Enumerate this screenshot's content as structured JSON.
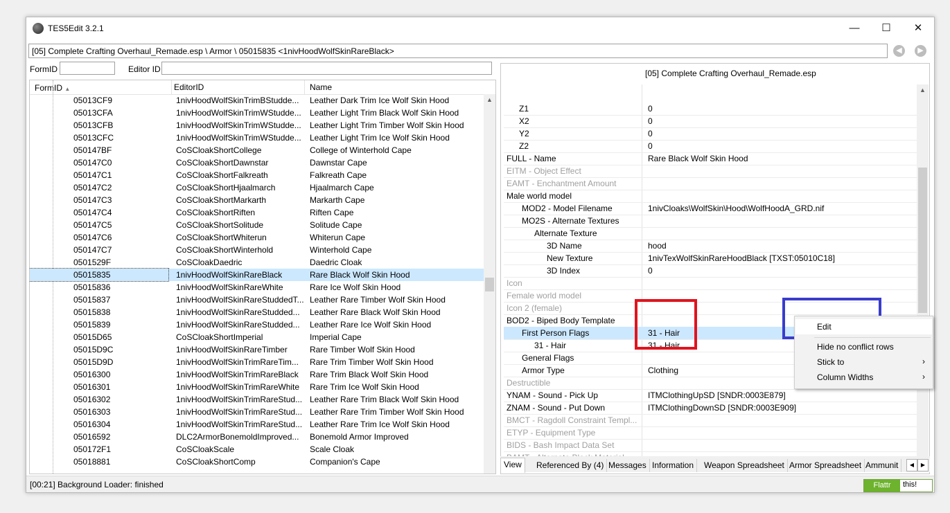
{
  "window": {
    "title": "TES5Edit 3.2.1",
    "minimize": "—",
    "maximize": "☐",
    "close": "✕"
  },
  "path": "[05] Complete Crafting Overhaul_Remade.esp \\ Armor \\ 05015835 <1nivHoodWolfSkinRareBlack>",
  "filter": {
    "formid_label": "FormID",
    "formid_value": "",
    "editorid_label": "Editor ID",
    "editorid_value": ""
  },
  "list": {
    "headers": [
      "FormID",
      "EditorID",
      "Name"
    ],
    "rows": [
      [
        "05013CF9",
        "1nivHoodWolfSkinTrimBStudde...",
        "Leather Dark Trim Ice Wolf Skin Hood"
      ],
      [
        "05013CFA",
        "1nivHoodWolfSkinTrimWStudde...",
        "Leather Light Trim Black Wolf Skin Hood"
      ],
      [
        "05013CFB",
        "1nivHoodWolfSkinTrimWStudde...",
        "Leather Light Trim Timber Wolf Skin Hood"
      ],
      [
        "05013CFC",
        "1nivHoodWolfSkinTrimWStudde...",
        "Leather Light Trim Ice Wolf Skin Hood"
      ],
      [
        "050147BF",
        "CoSCloakShortCollege",
        "College of Winterhold Cape"
      ],
      [
        "050147C0",
        "CoSCloakShortDawnstar",
        "Dawnstar Cape"
      ],
      [
        "050147C1",
        "CoSCloakShortFalkreath",
        "Falkreath Cape"
      ],
      [
        "050147C2",
        "CoSCloakShortHjaalmarch",
        "Hjaalmarch Cape"
      ],
      [
        "050147C3",
        "CoSCloakShortMarkarth",
        "Markarth Cape"
      ],
      [
        "050147C4",
        "CoSCloakShortRiften",
        "Riften Cape"
      ],
      [
        "050147C5",
        "CoSCloakShortSolitude",
        "Solitude Cape"
      ],
      [
        "050147C6",
        "CoSCloakShortWhiterun",
        "Whiterun Cape"
      ],
      [
        "050147C7",
        "CoSCloakShortWinterhold",
        "Winterhold Cape"
      ],
      [
        "0501529F",
        "CoSCloakDaedric",
        "Daedric Cloak"
      ],
      [
        "05015835",
        "1nivHoodWolfSkinRareBlack",
        "Rare Black Wolf Skin Hood"
      ],
      [
        "05015836",
        "1nivHoodWolfSkinRareWhite",
        "Rare Ice Wolf Skin Hood"
      ],
      [
        "05015837",
        "1nivHoodWolfSkinRareStuddedT...",
        "Leather Rare Timber Wolf Skin Hood"
      ],
      [
        "05015838",
        "1nivHoodWolfSkinRareStudded...",
        "Leather Rare Black Wolf Skin Hood"
      ],
      [
        "05015839",
        "1nivHoodWolfSkinRareStudded...",
        "Leather Rare Ice Wolf Skin Hood"
      ],
      [
        "05015D65",
        "CoSCloakShortImperial",
        "Imperial Cape"
      ],
      [
        "05015D9C",
        "1nivHoodWolfSkinRareTimber",
        "Rare Timber Wolf Skin Hood"
      ],
      [
        "05015D9D",
        "1nivHoodWolfSkinTrimRareTim...",
        "Rare Trim Timber Wolf Skin Hood"
      ],
      [
        "05016300",
        "1nivHoodWolfSkinTrimRareBlack",
        "Rare Trim Black Wolf Skin Hood"
      ],
      [
        "05016301",
        "1nivHoodWolfSkinTrimRareWhite",
        "Rare Trim Ice Wolf Skin Hood"
      ],
      [
        "05016302",
        "1nivHoodWolfSkinTrimRareStud...",
        "Leather Rare Trim Black Wolf Skin Hood"
      ],
      [
        "05016303",
        "1nivHoodWolfSkinTrimRareStud...",
        "Leather Rare Trim Timber Wolf Skin Hood"
      ],
      [
        "05016304",
        "1nivHoodWolfSkinTrimRareStud...",
        "Leather Rare Trim Ice Wolf Skin Hood"
      ],
      [
        "05016592",
        "DLC2ArmorBonemoldImproved...",
        "Bonemold Armor Improved"
      ],
      [
        "050172F1",
        "CoSCloakScale",
        "Scale Cloak"
      ],
      [
        "05018881",
        "CoSCloakShortComp",
        "Companion's Cape"
      ]
    ],
    "selected_index": 14
  },
  "details": {
    "header": "[05] Complete Crafting Overhaul_Remade.esp",
    "rows": [
      {
        "k": "Z1",
        "v": "0",
        "indent": 1,
        "gray": false
      },
      {
        "k": "X2",
        "v": "0",
        "indent": 1,
        "gray": false
      },
      {
        "k": "Y2",
        "v": "0",
        "indent": 1,
        "gray": false
      },
      {
        "k": "Z2",
        "v": "0",
        "indent": 1,
        "gray": false
      },
      {
        "k": "FULL - Name",
        "v": "Rare Black Wolf Skin Hood",
        "indent": 0,
        "gray": false
      },
      {
        "k": "EITM - Object Effect",
        "v": "",
        "indent": 0,
        "gray": true
      },
      {
        "k": "EAMT - Enchantment Amount",
        "v": "",
        "indent": 0,
        "gray": true
      },
      {
        "k": "Male world model",
        "v": "",
        "indent": 0,
        "gray": false
      },
      {
        "k": "MOD2 - Model Filename",
        "v": "1nivCloaks\\WolfSkin\\Hood\\WolfHoodA_GRD.nif",
        "indent": 1,
        "gray": false
      },
      {
        "k": "MO2S - Alternate Textures",
        "v": "",
        "indent": 1,
        "gray": false
      },
      {
        "k": "Alternate Texture",
        "v": "",
        "indent": 2,
        "gray": false
      },
      {
        "k": "3D Name",
        "v": "hood",
        "indent": 3,
        "gray": false
      },
      {
        "k": "New Texture",
        "v": "1nivTexWolfSkinRareHoodBlack [TXST:05010C18]",
        "indent": 3,
        "gray": false
      },
      {
        "k": "3D Index",
        "v": "0",
        "indent": 3,
        "gray": false
      },
      {
        "k": "Icon",
        "v": "",
        "indent": 0,
        "gray": true
      },
      {
        "k": "Female world model",
        "v": "",
        "indent": 0,
        "gray": true
      },
      {
        "k": "Icon 2 (female)",
        "v": "",
        "indent": 0,
        "gray": true
      },
      {
        "k": "BOD2 - Biped Body Template",
        "v": "",
        "indent": 0,
        "gray": false
      },
      {
        "k": "First Person Flags",
        "v": "31 - Hair",
        "indent": 1,
        "gray": false
      },
      {
        "k": "31 - Hair",
        "v": "31 - Hair",
        "indent": 2,
        "gray": false
      },
      {
        "k": "General Flags",
        "v": "",
        "indent": 1,
        "gray": false
      },
      {
        "k": "Armor Type",
        "v": "Clothing",
        "indent": 1,
        "gray": false
      },
      {
        "k": "Destructible",
        "v": "",
        "indent": 0,
        "gray": true
      },
      {
        "k": "YNAM - Sound - Pick Up",
        "v": "ITMClothingUpSD [SNDR:0003E879]",
        "indent": 0,
        "gray": false
      },
      {
        "k": "ZNAM - Sound - Put Down",
        "v": "ITMClothingDownSD [SNDR:0003E909]",
        "indent": 0,
        "gray": false
      },
      {
        "k": "BMCT - Ragdoll Constraint Templ...",
        "v": "",
        "indent": 0,
        "gray": true
      },
      {
        "k": "ETYP - Equipment Type",
        "v": "",
        "indent": 0,
        "gray": true
      },
      {
        "k": "BIDS - Bash Impact Data Set",
        "v": "",
        "indent": 0,
        "gray": true
      },
      {
        "k": "BAMT - Alternate Block Material",
        "v": "",
        "indent": 0,
        "gray": true
      }
    ],
    "selected_index": 18
  },
  "tabs": [
    "View",
    "Referenced By (4)",
    "Messages",
    "Information",
    "Weapon Spreadsheet",
    "Armor Spreadsheet",
    "Ammunit"
  ],
  "context_menu": {
    "items": [
      {
        "label": "Edit",
        "submenu": false
      },
      {
        "label": "Hide no conflict rows",
        "submenu": false
      },
      {
        "label": "Stick to",
        "submenu": true
      },
      {
        "label": "Column Widths",
        "submenu": true
      }
    ],
    "chevron": "›"
  },
  "status": "[00:21] Background Loader: finished",
  "flattr": {
    "left": "Flattr",
    "right": "this!"
  },
  "colors": {
    "selection": "#cce8ff",
    "red_highlight": "#e0141e",
    "blue_highlight": "#3a3ccb"
  }
}
